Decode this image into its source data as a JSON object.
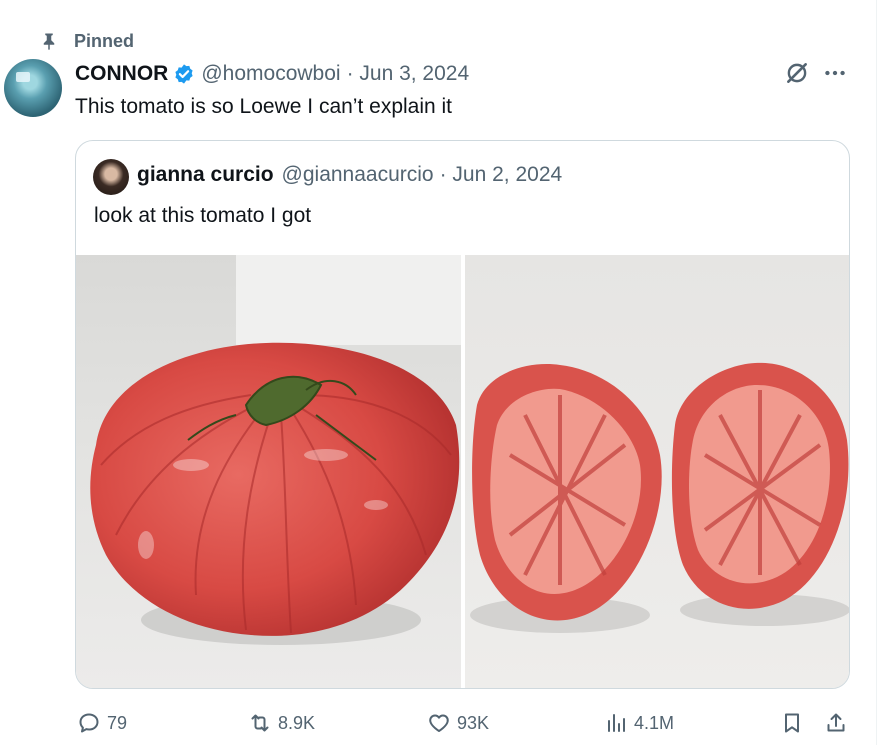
{
  "pinned": {
    "label": "Pinned",
    "icon": "pin-icon"
  },
  "tweet": {
    "author_name": "CONNOR",
    "author_handle": "@homocowboi",
    "date": "· Jun 3, 2024",
    "text": "This tomato is so Loewe I can’t explain it",
    "verified_color": "#1d9bf0"
  },
  "quoted": {
    "author_name": "gianna curcio",
    "author_handle": "@giannaacurcio",
    "date": "· Jun 2, 2024",
    "text": "look at this tomato I got"
  },
  "actions": {
    "replies": "79",
    "reposts": "8.9K",
    "likes": "93K",
    "views": "4.1M"
  },
  "colors": {
    "muted": "#536471",
    "text": "#0f1419",
    "border": "#cfd9de"
  }
}
